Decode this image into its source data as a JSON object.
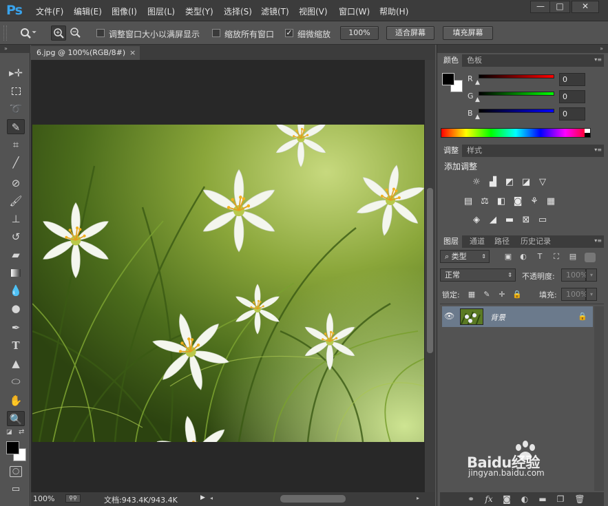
{
  "app": {
    "logo": "Ps"
  },
  "menu": [
    "文件(F)",
    "编辑(E)",
    "图像(I)",
    "图层(L)",
    "类型(Y)",
    "选择(S)",
    "滤镜(T)",
    "视图(V)",
    "窗口(W)",
    "帮助(H)"
  ],
  "window_controls": {
    "minimize": "—",
    "maximize": "□",
    "close": "✕"
  },
  "options": {
    "resize_windows_label": "调整窗口大小以满屏显示",
    "zoom_all_label": "缩放所有窗口",
    "scrubby_zoom_label": "细微缩放",
    "scrubby_checked": true,
    "zoom_100_label": "100%",
    "fit_screen_label": "适合屏幕",
    "fill_screen_label": "填充屏幕"
  },
  "tools": [
    "move-tool",
    "marquee-tool",
    "lasso-tool",
    "quick-select-tool",
    "crop-tool",
    "eyedropper-tool",
    "healing-brush-tool",
    "brush-tool",
    "clone-stamp-tool",
    "history-brush-tool",
    "eraser-tool",
    "gradient-tool",
    "blur-tool",
    "dodge-tool",
    "pen-tool",
    "type-tool",
    "path-select-tool",
    "ellipse-tool",
    "hand-tool",
    "zoom-tool"
  ],
  "document": {
    "tab_title": "6.jpg @ 100%(RGB/8#)",
    "tab_close": "×",
    "zoom": "100%",
    "doc_size": "文档:943.4K/943.4K"
  },
  "color_panel": {
    "tabs": [
      "颜色",
      "色板"
    ],
    "channels": [
      {
        "label": "R",
        "value": "0"
      },
      {
        "label": "G",
        "value": "0"
      },
      {
        "label": "B",
        "value": "0"
      }
    ]
  },
  "adjustments_panel": {
    "tabs": [
      "调整",
      "样式"
    ],
    "title": "添加调整",
    "icons_row1": [
      "brightness-icon",
      "levels-icon",
      "curves-icon",
      "exposure-icon",
      "vibrance-icon"
    ],
    "icons_row2": [
      "hue-saturation-icon",
      "color-balance-icon",
      "black-white-icon",
      "photo-filter-icon",
      "channel-mixer-icon",
      "color-lookup-icon"
    ],
    "icons_row3": [
      "invert-icon",
      "posterize-icon",
      "threshold-icon",
      "selective-color-icon",
      "gradient-map-icon"
    ]
  },
  "layers_panel": {
    "tabs": [
      "图层",
      "通道",
      "路径",
      "历史记录"
    ],
    "filter_kind": "类型",
    "blend_mode": "正常",
    "opacity_label": "不透明度:",
    "opacity_value": "100%",
    "lock_label": "锁定:",
    "fill_label": "填充:",
    "fill_value": "100%",
    "layers": [
      {
        "name": "背景",
        "visible": true,
        "locked": true
      }
    ]
  },
  "watermark": {
    "brand": "Baidu经验",
    "url": "jingyan.baidu.com"
  },
  "colors": {
    "accent": "#39a3ec",
    "layer_selected": "#6b7a8c",
    "panel_bg": "#535353",
    "canvas_bg": "#282828"
  }
}
